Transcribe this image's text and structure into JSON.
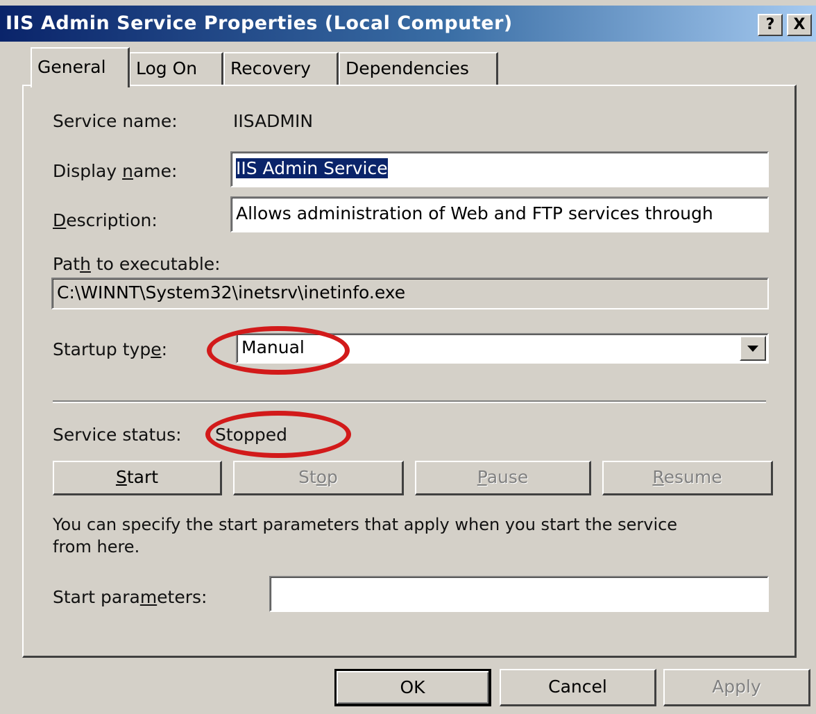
{
  "window": {
    "title": "IIS Admin Service Properties (Local Computer)",
    "help_label": "?",
    "close_label": "X"
  },
  "tabs": [
    "General",
    "Log On",
    "Recovery",
    "Dependencies"
  ],
  "general": {
    "service_name_label": "Service name:",
    "service_name_value": "IISADMIN",
    "display_name_label_pre": "Display ",
    "display_name_label_key": "n",
    "display_name_label_post": "ame:",
    "display_name_value": "IIS Admin Service",
    "description_label_key": "D",
    "description_label_post": "escription:",
    "description_value": "Allows administration of Web and FTP services through",
    "path_label_pre": "Pat",
    "path_label_key": "h",
    "path_label_post": " to executable:",
    "path_value": "C:\\WINNT\\System32\\inetsrv\\inetinfo.exe",
    "startup_label_pre": "Startup typ",
    "startup_label_key": "e",
    "startup_label_post": ":",
    "startup_value": "Manual",
    "status_label": "Service status:",
    "status_value": "Stopped",
    "buttons": {
      "start_key": "S",
      "start_rest": "tart",
      "stop_pre": "St",
      "stop_key": "o",
      "stop_rest": "p",
      "pause_key": "P",
      "pause_rest": "ause",
      "resume_key": "R",
      "resume_rest": "esume"
    },
    "help_text_line1": "You can specify the start parameters that apply when you start the service",
    "help_text_line2": "from here.",
    "params_label_pre": "Start para",
    "params_label_key": "m",
    "params_label_post": "eters:",
    "params_value": ""
  },
  "footer": {
    "ok_label": "OK",
    "cancel_label": "Cancel",
    "apply_label": "Apply"
  },
  "annotation_color": "#d21a1a"
}
